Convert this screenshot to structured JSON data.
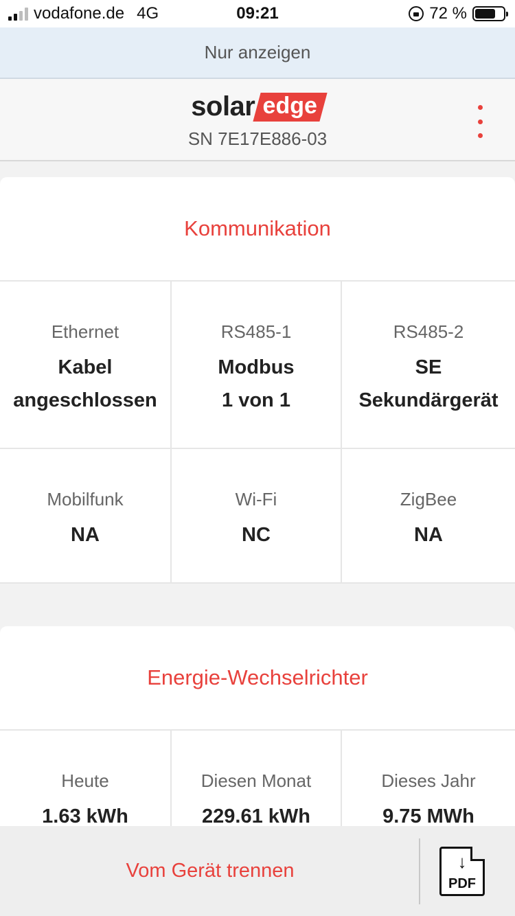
{
  "status_bar": {
    "carrier": "vodafone.de",
    "network": "4G",
    "time": "09:21",
    "battery_percent_text": "72 %",
    "battery_level": 0.72
  },
  "banner": {
    "text": "Nur anzeigen"
  },
  "header": {
    "logo_solar": "solar",
    "logo_edge": "edge",
    "serial": "SN 7E17E886-03"
  },
  "communication": {
    "title": "Kommunikation",
    "items": [
      {
        "label": "Ethernet",
        "value_line1": "Kabel",
        "value_line2": "angeschlossen"
      },
      {
        "label": "RS485-1",
        "value_line1": "Modbus",
        "value_line2": "1 von 1"
      },
      {
        "label": "RS485-2",
        "value_line1": "SE",
        "value_line2": "Sekundärgerät"
      },
      {
        "label": "Mobilfunk",
        "value_line1": "NA"
      },
      {
        "label": "Wi-Fi",
        "value_line1": "NC"
      },
      {
        "label": "ZigBee",
        "value_line1": "NA"
      }
    ]
  },
  "energy": {
    "title": "Energie-Wechselrichter",
    "items": [
      {
        "label": "Heute",
        "value": "1.63 kWh"
      },
      {
        "label": "Diesen Monat",
        "value": "229.61 kWh"
      },
      {
        "label": "Dieses Jahr",
        "value": "9.75 MWh"
      }
    ]
  },
  "bottom_bar": {
    "disconnect_label": "Vom Gerät trennen",
    "pdf_label": "PDF",
    "pdf_arrow": "↓"
  },
  "colors": {
    "accent": "#e8413c",
    "banner_bg": "#e5eef7"
  },
  "icons": [
    "signal-icon",
    "lock-rotation-icon",
    "battery-icon",
    "more-vertical-icon",
    "pdf-download-icon"
  ]
}
